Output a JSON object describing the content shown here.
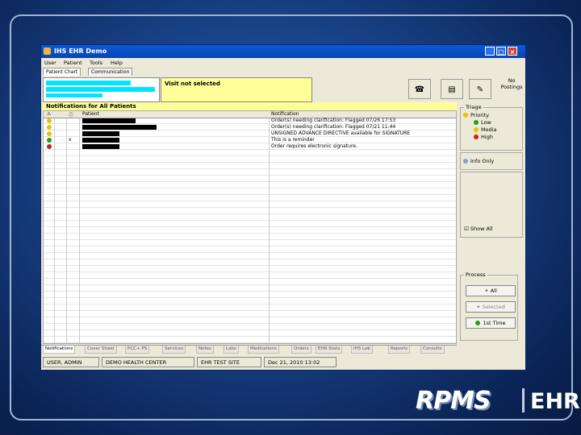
{
  "window": {
    "title": "IHS EHR Demo",
    "controls": {
      "minimize": "_",
      "maximize": "□",
      "close": "×"
    }
  },
  "menu": [
    "User",
    "Patient",
    "Tools",
    "Help"
  ],
  "patient_tabs": [
    "Patient Chart",
    "Communication"
  ],
  "visit": {
    "label": "Visit not selected"
  },
  "toolbar": {
    "no_postings": "No Postings"
  },
  "notifications": {
    "header": "Notifications for All Patients",
    "columns": {
      "patient": "Patient",
      "notification": "Notification"
    },
    "rows": [
      {
        "status": "yellow",
        "mark": "",
        "note": "Order(s) needing clarification: Flagged 07/26 17:53"
      },
      {
        "status": "yellow",
        "mark": "",
        "note": "Order(s) needing clarification: Flagged 07/21 11:44"
      },
      {
        "status": "yellow",
        "mark": "",
        "note": "UNSIGNED ADVANCE DIRECTIVE available for SIGNATURE"
      },
      {
        "status": "green",
        "mark": "x",
        "note": "This is a reminder"
      },
      {
        "status": "red",
        "mark": "",
        "note": "Order requires electronic signature."
      }
    ]
  },
  "triage": {
    "label": "Triage",
    "priority": "Priority",
    "low": "Low",
    "medium": "Media",
    "high": "High",
    "info_only": "Info Only",
    "show_all": "Show All"
  },
  "process": {
    "label": "Process",
    "all": "All",
    "selected": "Selected",
    "first_time": "1st Time"
  },
  "bottom_tabs": [
    "Notifications",
    "Cover Sheet",
    "PCC+ PS",
    "Services",
    "Notes",
    "Labs",
    "Medications",
    "Orders",
    "EHR Stats",
    "IHS Lab",
    "Reports",
    "Consults"
  ],
  "status": {
    "user": "USER, ADMIN",
    "location": "DEMO HEALTH CENTER",
    "dept": "EHR TEST SITE",
    "date": "Dec 21, 2010 13:02"
  },
  "logo": {
    "mark": "RPMS",
    "text": "EHR"
  },
  "colors": {
    "priority_yellow": "#e8c400",
    "low_green": "#1f9e1f",
    "high_red": "#cc1f1f",
    "highlight_cyan": "#00e5ff",
    "visit_yellow": "#ffff99"
  }
}
